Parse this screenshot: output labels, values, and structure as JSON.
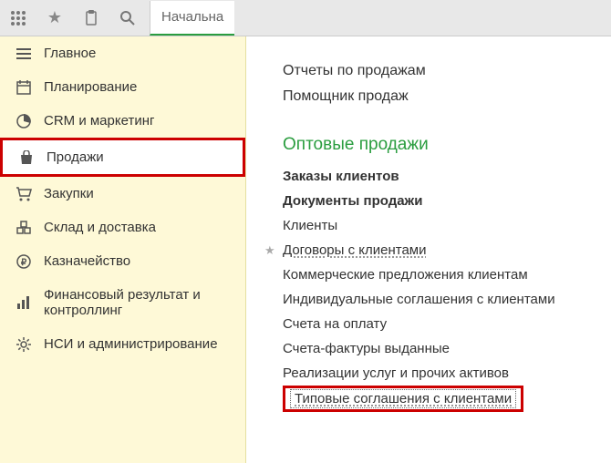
{
  "toolbar": {
    "tab_label": "Начальна"
  },
  "sidebar": {
    "items": [
      {
        "label": "Главное",
        "icon": "menu-icon"
      },
      {
        "label": "Планирование",
        "icon": "calendar-icon"
      },
      {
        "label": "CRM и маркетинг",
        "icon": "pie-icon"
      },
      {
        "label": "Продажи",
        "icon": "bag-icon"
      },
      {
        "label": "Закупки",
        "icon": "cart-icon"
      },
      {
        "label": "Склад и доставка",
        "icon": "warehouse-icon"
      },
      {
        "label": "Казначейство",
        "icon": "ruble-icon"
      },
      {
        "label": "Финансовый результат и контроллинг",
        "icon": "chart-icon"
      },
      {
        "label": "НСИ и администрирование",
        "icon": "gear-icon"
      }
    ]
  },
  "content": {
    "top_links": [
      "Отчеты по продажам",
      "Помощник продаж"
    ],
    "section_title": "Оптовые продажи",
    "menu": [
      {
        "label": "Заказы клиентов",
        "bold": true
      },
      {
        "label": "Документы продажи",
        "bold": true
      },
      {
        "label": "Клиенты"
      },
      {
        "label": "Договоры с клиентами",
        "underline": true,
        "starred": true
      },
      {
        "label": "Коммерческие предложения клиентам"
      },
      {
        "label": "Индивидуальные соглашения с клиентами"
      },
      {
        "label": "Счета на оплату"
      },
      {
        "label": "Счета-фактуры выданные"
      },
      {
        "label": "Реализации услуг и прочих активов"
      },
      {
        "label": "Типовые соглашения с клиентами",
        "underline": true,
        "highlighted": true
      }
    ]
  }
}
